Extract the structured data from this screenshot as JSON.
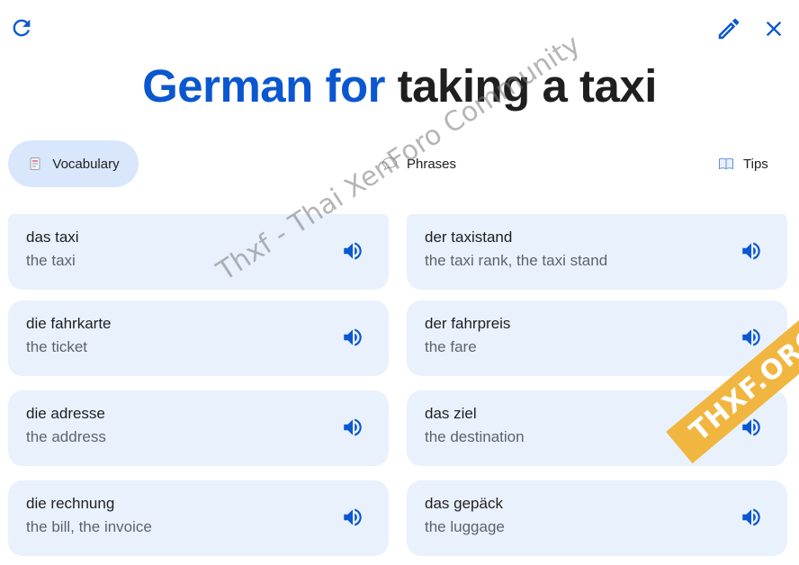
{
  "header": {
    "title_accent": "German for",
    "title_rest": "taking a taxi"
  },
  "icons": {
    "refresh": "refresh-icon",
    "edit": "pencil-icon",
    "close": "close-icon"
  },
  "tabs": [
    {
      "label": "Vocabulary",
      "icon": "document-icon",
      "selected": true
    },
    {
      "label": "Phrases",
      "icon": "speech-bubble-icon",
      "selected": false
    },
    {
      "label": "Tips",
      "icon": "book-icon",
      "selected": false
    }
  ],
  "vocabulary": [
    {
      "term": "das taxi",
      "meaning": "the taxi"
    },
    {
      "term": "der taxistand",
      "meaning": "the taxi rank, the taxi stand"
    },
    {
      "term": "die fahrkarte",
      "meaning": "the ticket"
    },
    {
      "term": "der fahrpreis",
      "meaning": "the fare"
    },
    {
      "term": "die adresse",
      "meaning": "the address"
    },
    {
      "term": "das ziel",
      "meaning": "the destination"
    },
    {
      "term": "die rechnung",
      "meaning": "the bill, the invoice"
    },
    {
      "term": "das gepäck",
      "meaning": "the luggage"
    }
  ],
  "watermark": {
    "text": "Thxf - Thai XenForo Community",
    "badge": "THXF.ORG"
  },
  "colors": {
    "accent": "#0b57d0",
    "card_bg": "#e9f1fd",
    "selected_tab_bg": "#d9e7fd"
  }
}
